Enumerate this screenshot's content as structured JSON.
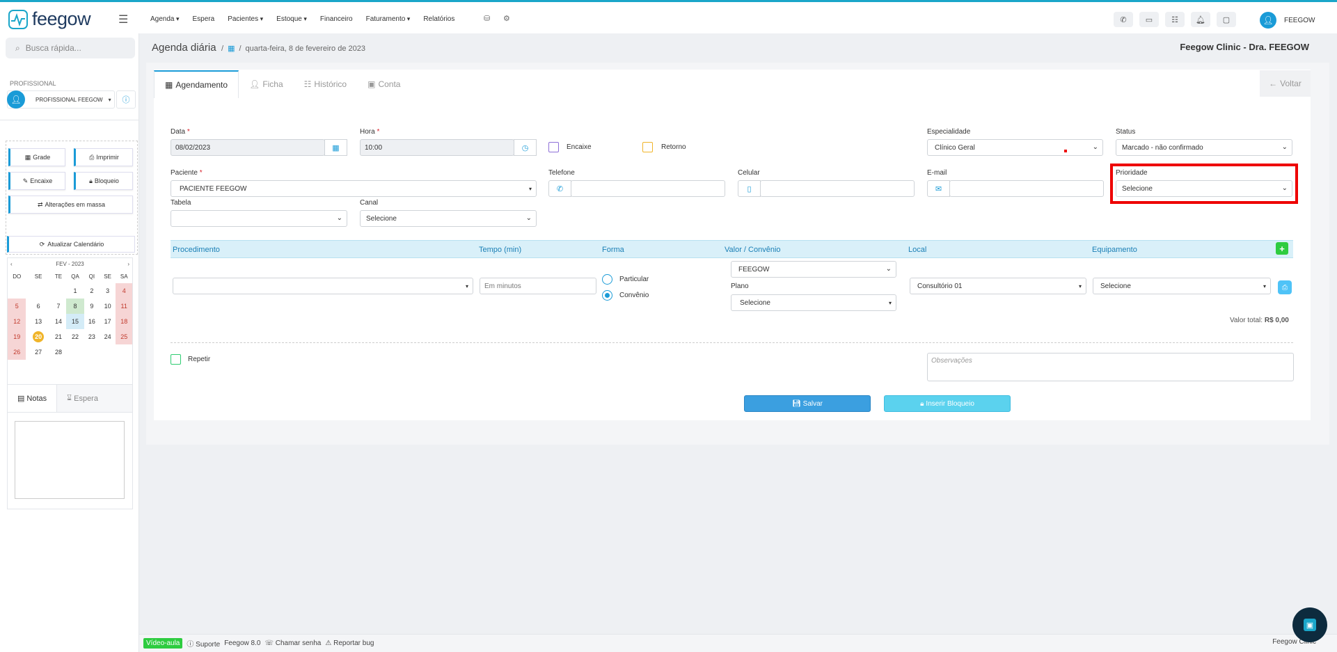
{
  "nav": {
    "logo": "feegow",
    "menu": [
      "Agenda",
      "Espera",
      "Pacientes",
      "Estoque",
      "Financeiro",
      "Faturamento",
      "Relatórios"
    ],
    "user": "FEEGOW"
  },
  "sidebar": {
    "search_placeholder": "Busca rápida...",
    "professional_label": "PROFISSIONAL",
    "professional_name": "PROFISSIONAL FEEGOW",
    "buttons": {
      "grade": "Grade",
      "imprimir": "Imprimir",
      "encaixe": "Encaixe",
      "bloqueio": "Bloqueio",
      "alteracoes": "Alterações em massa",
      "atualizar": "Atualizar Calendário"
    },
    "calendar": {
      "month": "FEV - 2023",
      "weekdays": [
        "DO",
        "SE",
        "TE",
        "QA",
        "QI",
        "SE",
        "SA"
      ],
      "weeks": [
        [
          "",
          "",
          "",
          "1",
          "2",
          "3",
          "4"
        ],
        [
          "5",
          "6",
          "7",
          "8",
          "9",
          "10",
          "11"
        ],
        [
          "12",
          "13",
          "14",
          "15",
          "16",
          "17",
          "18"
        ],
        [
          "19",
          "20",
          "21",
          "22",
          "23",
          "24",
          "25"
        ],
        [
          "26",
          "27",
          "28",
          "",
          "",
          "",
          ""
        ]
      ]
    },
    "notes_tab": "Notas",
    "espera_tab": "Espera"
  },
  "header": {
    "title": "Agenda diária",
    "date": "quarta-feira, 8 de fevereiro de 2023",
    "clinic": "Feegow Clinic - Dra. FEEGOW"
  },
  "tabs": [
    "Agendamento",
    "Ficha",
    "Histórico",
    "Conta"
  ],
  "voltar": "Voltar",
  "form": {
    "data_label": "Data",
    "data_value": "08/02/2023",
    "hora_label": "Hora",
    "hora_value": "10:00",
    "encaixe": "Encaixe",
    "retorno": "Retorno",
    "especialidade_label": "Especialidade",
    "especialidade_value": "Clínico Geral",
    "status_label": "Status",
    "status_value": "Marcado - não confirmado",
    "paciente_label": "Paciente",
    "paciente_value": "PACIENTE FEEGOW",
    "telefone_label": "Telefone",
    "celular_label": "Celular",
    "email_label": "E-mail",
    "prioridade_label": "Prioridade",
    "prioridade_value": "Selecione",
    "tabela_label": "Tabela",
    "canal_label": "Canal",
    "canal_value": "Selecione"
  },
  "procedimento": {
    "headers": [
      "Procedimento",
      "Tempo (min)",
      "Forma",
      "Valor / Convênio",
      "Local",
      "Equipamento"
    ],
    "tempo_placeholder": "Em minutos",
    "particular": "Particular",
    "convenio": "Convênio",
    "convenio_value": "FEEGOW",
    "plano_label": "Plano",
    "plano_value": "Selecione",
    "local_value": "Consultório 01",
    "equipamento_value": "Selecione",
    "valor_total_label": "Valor total:",
    "valor_total": "R$ 0,00"
  },
  "repetir": "Repetir",
  "observacoes_placeholder": "Observações",
  "buttons": {
    "salvar": "Salvar",
    "inserir_bloqueio": "Inserir Bloqueio"
  },
  "footer": {
    "video": "Vídeo-aula",
    "suporte": "Suporte",
    "version": "Feegow 8.0",
    "chamar": "Chamar senha",
    "bug": "Reportar bug",
    "right": "Feegow Clinic"
  }
}
